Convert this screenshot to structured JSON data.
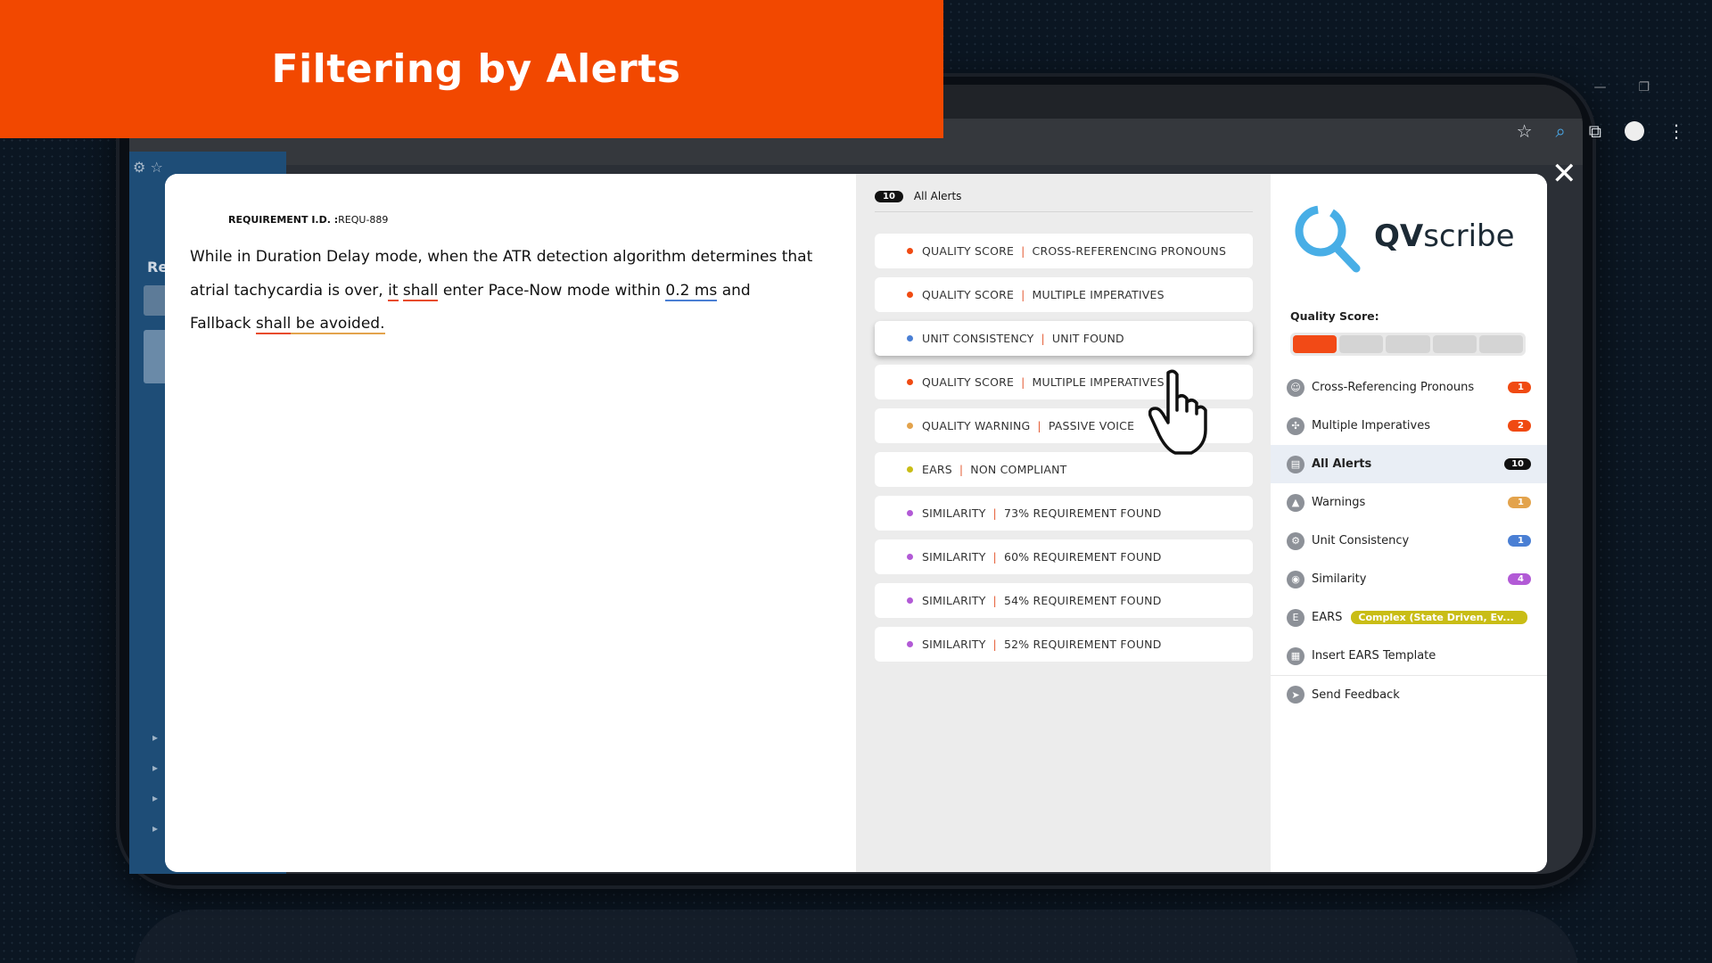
{
  "banner": {
    "title": "Filtering by Alerts"
  },
  "modal": {
    "close_glyph": "✕"
  },
  "requirement": {
    "id_label": "REQUIREMENT I.D. :",
    "id_value": "REQU-889",
    "text": {
      "p1": "While in Duration Delay mode, when the ATR detection algorithm determines that atrial tachycardia is over,",
      "w_it": "it",
      "w_shall": "shall",
      "p2": "enter Pace-Now mode within",
      "w_unit": "0.2 ms",
      "p3": "and Fallback",
      "w_shall2": "shall",
      "w_avoided": "be avoided."
    }
  },
  "alerts": {
    "header_count": "10",
    "header_label": "All Alerts",
    "items": [
      {
        "type": "QUALITY SCORE",
        "detail": "CROSS-REFERENCING PRONOUNS",
        "color": "#f04a12"
      },
      {
        "type": "QUALITY SCORE",
        "detail": "MULTIPLE IMPERATIVES",
        "color": "#f04a12"
      },
      {
        "type": "UNIT CONSISTENCY",
        "detail": "UNIT FOUND",
        "color": "#4a7fd4"
      },
      {
        "type": "QUALITY SCORE",
        "detail": "MULTIPLE IMPERATIVES",
        "color": "#f04a12"
      },
      {
        "type": "QUALITY WARNING",
        "detail": "PASSIVE VOICE",
        "color": "#e3a34c"
      },
      {
        "type": "EARS",
        "detail": "NON  COMPLIANT",
        "color": "#c9bd16"
      },
      {
        "type": "SIMILARITY",
        "detail": "73% REQUIREMENT FOUND",
        "color": "#b25ad6"
      },
      {
        "type": "SIMILARITY",
        "detail": "60% REQUIREMENT FOUND",
        "color": "#b25ad6"
      },
      {
        "type": "SIMILARITY",
        "detail": "54% REQUIREMENT FOUND",
        "color": "#b25ad6"
      },
      {
        "type": "SIMILARITY",
        "detail": "52% REQUIREMENT FOUND",
        "color": "#b25ad6"
      }
    ]
  },
  "qvscribe": {
    "logo_bold": "QV",
    "logo_rest": "scribe",
    "quality_label": "Quality Score:",
    "quality_filled": 1,
    "quality_total": 5,
    "menu": [
      {
        "key": "cross",
        "label": "Cross-Referencing Pronouns",
        "count": "1",
        "color": "#f04a12"
      },
      {
        "key": "mult",
        "label": "Multiple Imperatives",
        "count": "2",
        "color": "#f04a12"
      },
      {
        "key": "all",
        "label": "All Alerts",
        "count": "10",
        "color": "#111111"
      },
      {
        "key": "warn",
        "label": "Warnings",
        "count": "1",
        "color": "#e3a34c"
      },
      {
        "key": "unit",
        "label": "Unit Consistency",
        "count": "1",
        "color": "#4a7fd4"
      },
      {
        "key": "sim",
        "label": "Similarity",
        "count": "4",
        "color": "#b25ad6"
      },
      {
        "key": "ears",
        "label": "EARS",
        "ears_text": "Complex (State Driven, Ev...",
        "color": "#c9bd16"
      },
      {
        "key": "tmpl",
        "label": "Insert EARS Template"
      },
      {
        "key": "feedback",
        "label": "Send Feedback"
      }
    ]
  }
}
